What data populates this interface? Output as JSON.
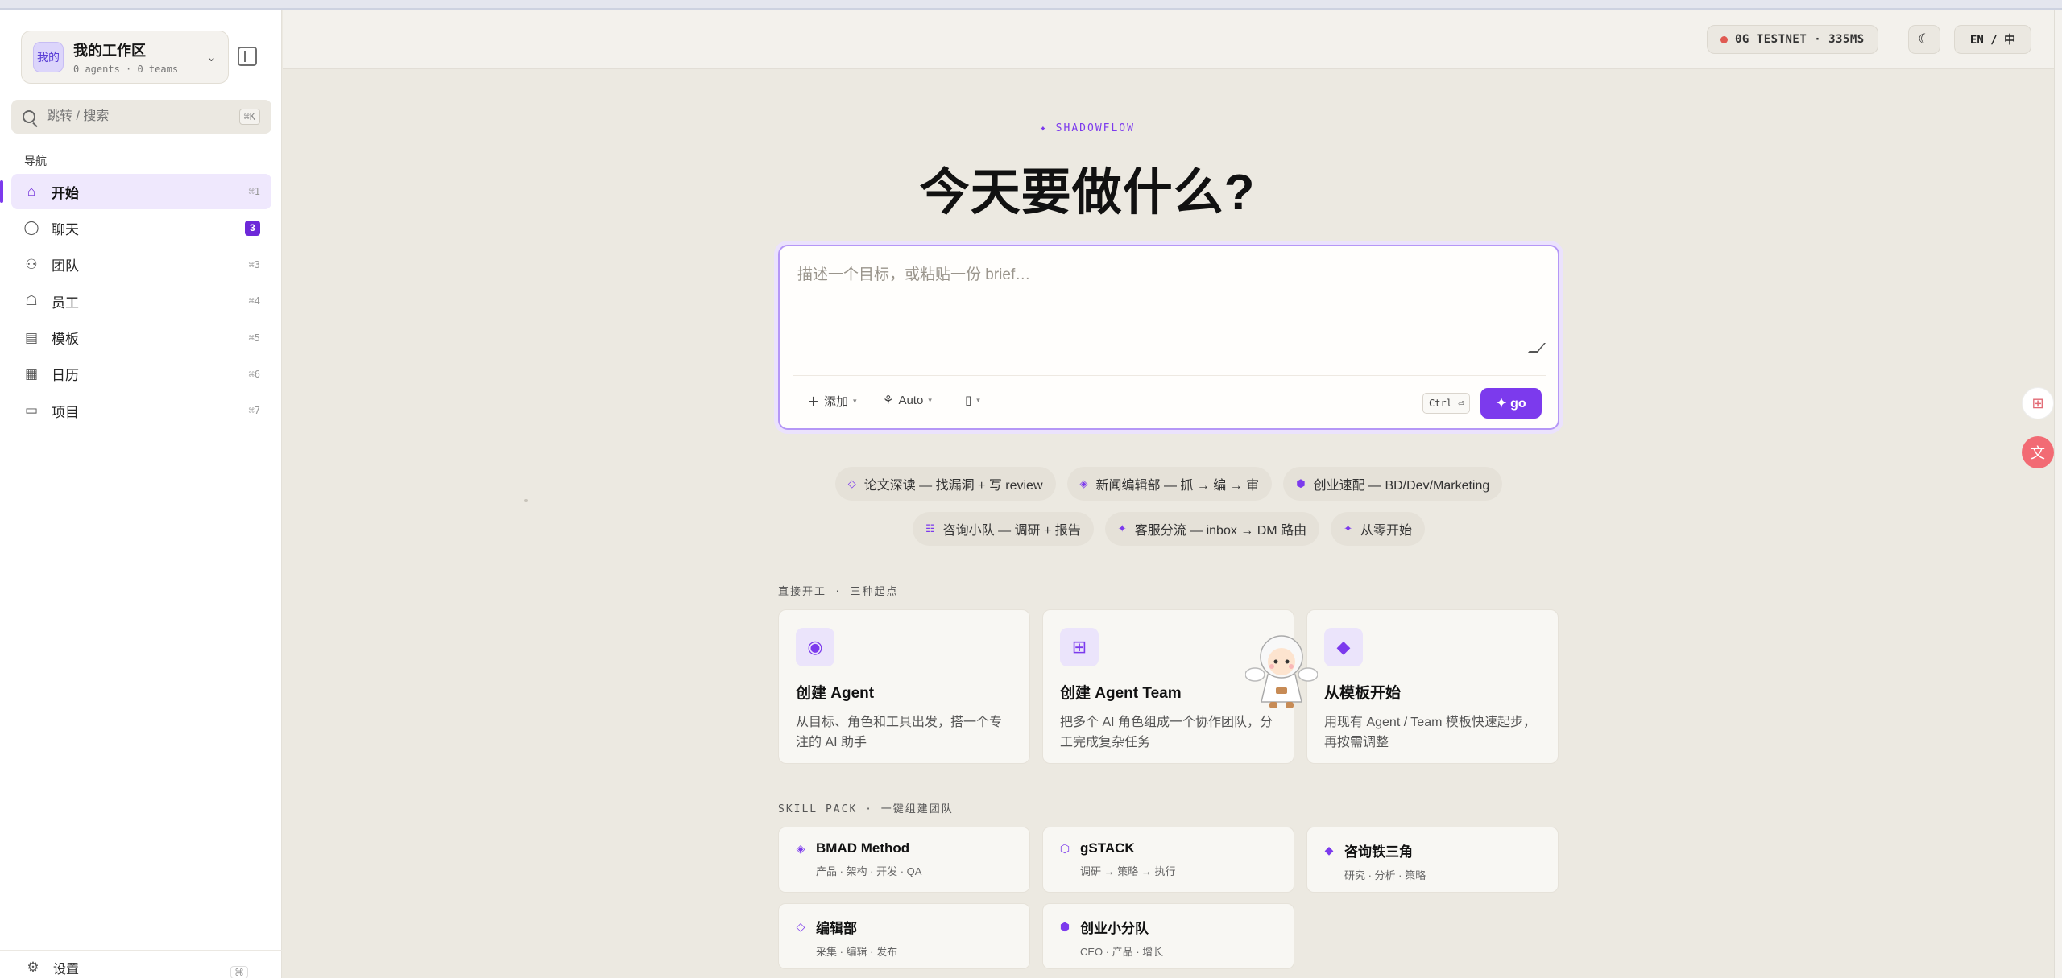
{
  "workspace": {
    "avatar": "我的",
    "title": "我的工作区",
    "subtitle": "0 agents · 0 teams"
  },
  "search": {
    "placeholder": "跳转 / 搜索",
    "shortcut": "⌘K"
  },
  "nav": {
    "heading": "导航",
    "items": [
      {
        "label": "开始",
        "shortcut": "⌘1",
        "icon": "home-icon",
        "glyph": "⌂"
      },
      {
        "label": "聊天",
        "badge": "3",
        "icon": "chat-icon",
        "glyph": "◯"
      },
      {
        "label": "团队",
        "shortcut": "⌘3",
        "icon": "users-icon",
        "glyph": "⚇"
      },
      {
        "label": "员工",
        "shortcut": "⌘4",
        "icon": "robot-icon",
        "glyph": "☖"
      },
      {
        "label": "模板",
        "shortcut": "⌘5",
        "icon": "template-icon",
        "glyph": "▤"
      },
      {
        "label": "日历",
        "shortcut": "⌘6",
        "icon": "calendar-icon",
        "glyph": "▦"
      },
      {
        "label": "项目",
        "shortcut": "⌘7",
        "icon": "folder-icon",
        "glyph": "▭"
      }
    ],
    "settings_label": "设置",
    "settings_shortcut": "⌘"
  },
  "header": {
    "network": "0G TESTNET · 335MS",
    "language": "EN / 中"
  },
  "main": {
    "eyebrow": "✦ SHADOWFLOW",
    "title": "今天要做什么?",
    "composer": {
      "placeholder": "描述一个目标，或粘贴一份 brief…",
      "add_label": "添加",
      "mode_label": "Auto",
      "shortcut": "Ctrl ⏎",
      "go_label": "✦ go"
    },
    "chips_row1": [
      {
        "icon": "◇",
        "label": "论文深读 — 找漏洞 + 写 review"
      },
      {
        "icon": "◈",
        "label": "新闻编辑部 — 抓 → 编 → 审"
      },
      {
        "icon": "⬢",
        "label": "创业速配 — BD/Dev/Marketing"
      }
    ],
    "chips_row2": [
      {
        "icon": "☷",
        "label": "咨询小队 — 调研 + 报告"
      },
      {
        "icon": "✦",
        "label": "客服分流 — inbox → DM 路由"
      },
      {
        "icon": "✦",
        "label": "从零开始"
      }
    ],
    "start_label": "直接开工 · 三种起点",
    "start_cards": [
      {
        "icon": "◉",
        "title": "创建 Agent",
        "desc": "从目标、角色和工具出发，搭一个专注的 AI 助手"
      },
      {
        "icon": "⊞",
        "title": "创建 Agent Team",
        "desc": "把多个 AI 角色组成一个协作团队，分工完成复杂任务"
      },
      {
        "icon": "◆",
        "title": "从模板开始",
        "desc": "用现有 Agent / Team 模板快速起步，再按需调整"
      }
    ],
    "skill_label": "SKILL PACK · 一键组建团队",
    "skills": [
      {
        "icon": "◈",
        "name": "BMAD Method",
        "desc": "产品 · 架构 · 开发 · QA"
      },
      {
        "icon": "⬡",
        "name": "gSTACK",
        "desc": "调研 → 策略 → 执行"
      },
      {
        "icon": "◆",
        "name": "咨询铁三角",
        "desc": "研究 · 分析 · 策略"
      },
      {
        "icon": "◇",
        "name": "编辑部",
        "desc": "采集 · 编辑 · 发布"
      },
      {
        "icon": "⬢",
        "name": "创业小分队",
        "desc": "CEO · 产品 · 增长"
      }
    ]
  },
  "colors": {
    "accent": "#7c3aed",
    "background": "#ece9e1",
    "status_dot": "#e05a52"
  }
}
